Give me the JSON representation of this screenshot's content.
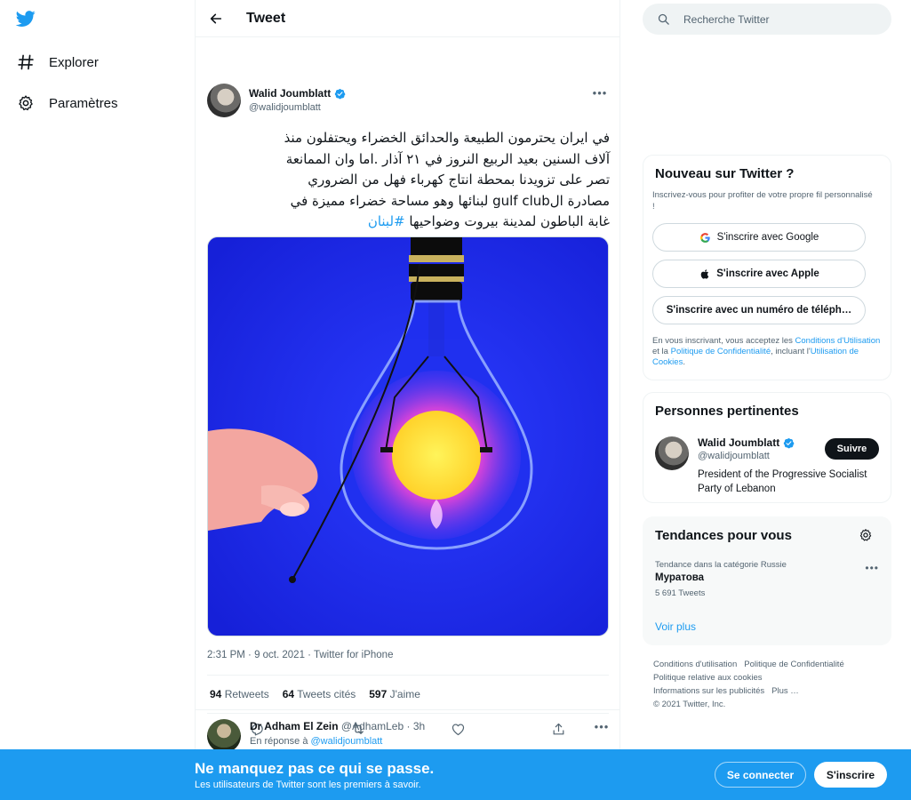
{
  "colors": {
    "accent": "#1d9bf0",
    "text": "#0f1419",
    "muted": "#536471",
    "banner": "#1d9bf0"
  },
  "nav": {
    "logo_icon": "twitter-bird-icon",
    "items": [
      {
        "label": "Explorer",
        "icon": "hashtag-icon"
      },
      {
        "label": "Paramètres",
        "icon": "gear-icon"
      }
    ]
  },
  "header": {
    "title": "Tweet",
    "back_icon": "arrow-left-icon"
  },
  "tweet": {
    "author_name": "Walid Joumblatt",
    "author_handle": "@walidjoumblatt",
    "verified": true,
    "text_lines": [
      "في ايران يحترمون الطبيعة والحدائق الخضراء ويحتفلون منذ",
      "آلاف السنين بعيد الربيع النروز في ٢١ آذار .اما وان الممانعة",
      "تصر على تزويدنا بمحطة انتاج كهرباء فهل من الضروري",
      "مصادرة الgulf club لبنائها وهو مساحة خضراء مميزة في",
      "غابة الباطون  لمدينة بيروت وضواحيها"
    ],
    "hashtag": "#لبنان",
    "meta_time": "2:31 PM",
    "meta_dot": " · ",
    "meta_date": "9 oct. 2021",
    "meta_source": "Twitter for iPhone",
    "stats": [
      {
        "count": "94",
        "label": "Retweets"
      },
      {
        "count": "64",
        "label": "Tweets cités"
      },
      {
        "count": "597",
        "label": "J'aime"
      }
    ],
    "actions": [
      "reply-icon",
      "retweet-icon",
      "like-icon",
      "share-icon"
    ]
  },
  "reply": {
    "author_name": "Dr Adham El Zein",
    "author_handle": "@AdhamLeb",
    "dot": " · ",
    "time": "3h",
    "reply_prefix": "En réponse à ",
    "reply_to": "@walidjoumblatt"
  },
  "search": {
    "placeholder": "Recherche Twitter"
  },
  "signup": {
    "title": "Nouveau sur Twitter ?",
    "subtitle": "Inscrivez-vous pour profiter de votre propre fil personnalisé !",
    "google": "S'inscrire avec Google",
    "apple": "S'inscrire avec Apple",
    "phone": "S'inscrire avec un numéro de téléph…",
    "terms_1": "En vous inscrivant, vous acceptez les ",
    "terms_link_1": "Conditions d'Utilisation",
    "terms_2": " et la ",
    "terms_link_2": "Politique de Confidentialité",
    "terms_3": ", incluant l'",
    "terms_link_3": "Utilisation de Cookies",
    "terms_4": "."
  },
  "people": {
    "title": "Personnes pertinentes",
    "name": "Walid Joumblatt",
    "handle": "@walidjoumblatt",
    "bio": "President of the Progressive Socialist Party of Lebanon",
    "follow": "Suivre"
  },
  "trends": {
    "title": "Tendances pour vous",
    "category": "Tendance dans la catégorie Russie",
    "name": "Муратова",
    "count": "5 691 Tweets",
    "more": "Voir plus"
  },
  "footer": {
    "links": [
      "Conditions d'utilisation",
      "Politique de Confidentialité",
      "Politique relative aux cookies",
      "Informations sur les publicités",
      "Plus …"
    ],
    "copyright": "© 2021 Twitter, Inc."
  },
  "banner": {
    "title": "Ne manquez pas ce qui se passe.",
    "subtitle": "Les utilisateurs de Twitter sont les premiers à savoir.",
    "login": "Se connecter",
    "signup": "S'inscrire"
  }
}
